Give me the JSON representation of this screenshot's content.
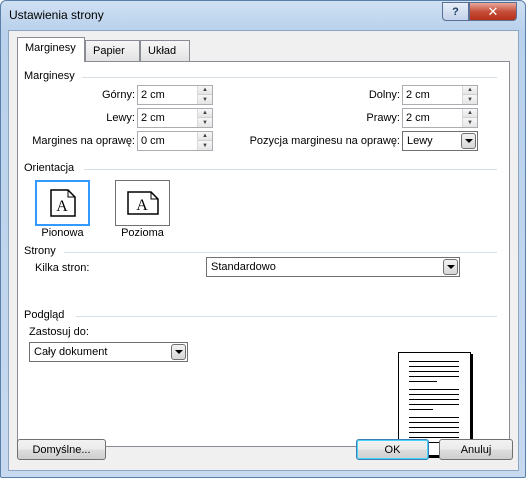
{
  "window": {
    "title": "Ustawienia strony",
    "help_glyph": "?",
    "close_glyph": "✕"
  },
  "tabs": [
    {
      "label": "Marginesy",
      "active": true
    },
    {
      "label": "Papier",
      "active": false
    },
    {
      "label": "Układ",
      "active": false
    }
  ],
  "margins": {
    "section_label": "Marginesy",
    "top": {
      "label": "Górny:",
      "value": "2 cm"
    },
    "bottom": {
      "label": "Dolny:",
      "value": "2 cm"
    },
    "left": {
      "label": "Lewy:",
      "value": "2 cm"
    },
    "right": {
      "label": "Prawy:",
      "value": "2 cm"
    },
    "gutter": {
      "label": "Margines na oprawę:",
      "value": "0 cm"
    },
    "gutter_position": {
      "label": "Pozycja marginesu na oprawę:",
      "value": "Lewy"
    }
  },
  "orientation": {
    "section_label": "Orientacja",
    "icon_glyph": "A",
    "portrait": {
      "label": "Pionowa",
      "selected": true
    },
    "landscape": {
      "label": "Pozioma",
      "selected": false
    }
  },
  "pages": {
    "section_label": "Strony",
    "multiple_label": "Kilka stron:",
    "multiple_value": "Standardowo"
  },
  "preview": {
    "section_label": "Podgląd",
    "apply_label": "Zastosuj do:",
    "apply_value": "Cały dokument"
  },
  "buttons": {
    "default": "Domyślne...",
    "ok": "OK",
    "cancel": "Anuluj"
  },
  "colors": {
    "selected_border": "#3399ff",
    "title_bar": "#b9d1ec"
  }
}
